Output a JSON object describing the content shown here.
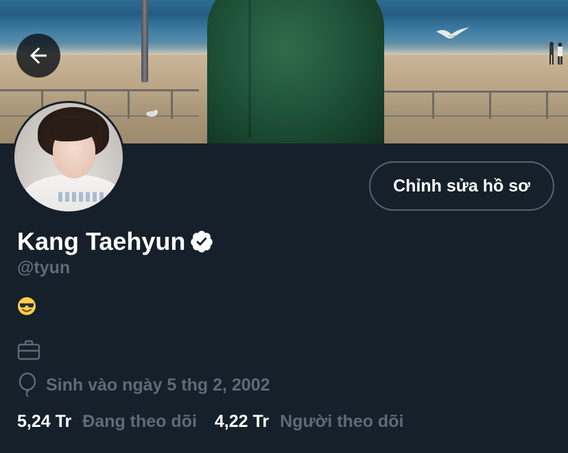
{
  "colors": {
    "background": "#15202b",
    "primary_text": "#ffffff",
    "secondary_text": "#5b6b79",
    "button_border": "#536471",
    "verified_badge": "#ffffff"
  },
  "header": {
    "back_icon": "arrow-left-icon"
  },
  "profile": {
    "display_name": "Kang Taehyun",
    "verified_icon": "verified-badge-icon",
    "handle": "@tyun",
    "bio_emoji": "😎",
    "job_icon": "briefcase-icon",
    "birth_icon": "balloon-icon",
    "birth_text": "Sinh vào ngày 5 thg 2, 2002",
    "edit_profile_label": "Chỉnh sửa hồ sơ"
  },
  "stats": {
    "following_count": "5,24 Tr",
    "following_label": "Đang theo dõi",
    "followers_count": "4,22 Tr",
    "followers_label": "Người theo dõi"
  }
}
